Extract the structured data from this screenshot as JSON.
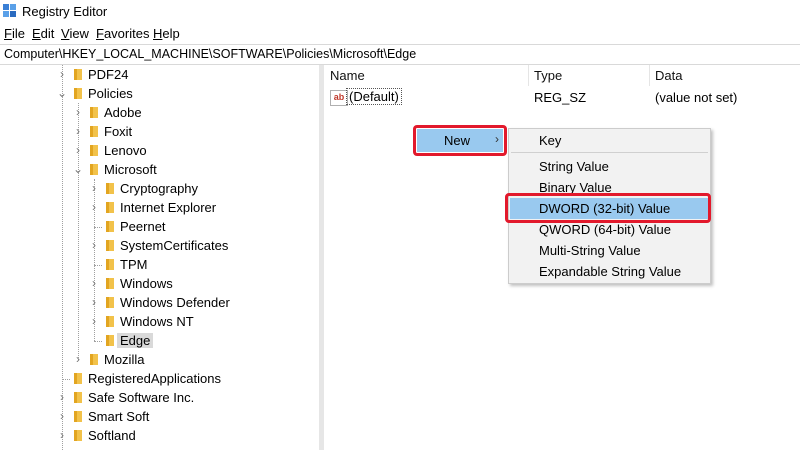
{
  "window": {
    "title": "Registry Editor"
  },
  "menubar": {
    "items": [
      {
        "underline": "F",
        "rest": "ile"
      },
      {
        "underline": "E",
        "rest": "dit"
      },
      {
        "underline": "V",
        "rest": "iew"
      },
      {
        "underline": "F",
        "rest": "avorites",
        "prefix": ""
      },
      {
        "underline": "H",
        "rest": "elp"
      }
    ]
  },
  "address": {
    "path": "Computer\\HKEY_LOCAL_MACHINE\\SOFTWARE\\Policies\\Microsoft\\Edge"
  },
  "tree": {
    "items": [
      {
        "label": "PDF24",
        "chevron": "›"
      },
      {
        "label": "Policies",
        "chevron": "⌄"
      },
      {
        "label": "Adobe",
        "chevron": "›"
      },
      {
        "label": "Foxit",
        "chevron": "›"
      },
      {
        "label": "Lenovo",
        "chevron": "›"
      },
      {
        "label": "Microsoft",
        "chevron": "⌄"
      },
      {
        "label": "Cryptography",
        "chevron": "›"
      },
      {
        "label": "Internet Explorer",
        "chevron": "›"
      },
      {
        "label": "Peernet",
        "chevron": ""
      },
      {
        "label": "SystemCertificates",
        "chevron": "›"
      },
      {
        "label": "TPM",
        "chevron": ""
      },
      {
        "label": "Windows",
        "chevron": "›"
      },
      {
        "label": "Windows Defender",
        "chevron": "›"
      },
      {
        "label": "Windows NT",
        "chevron": "›"
      },
      {
        "label": "Edge",
        "chevron": ""
      },
      {
        "label": "Mozilla",
        "chevron": "›"
      },
      {
        "label": "RegisteredApplications",
        "chevron": ""
      },
      {
        "label": "Safe Software Inc.",
        "chevron": "›"
      },
      {
        "label": "Smart Soft",
        "chevron": "›"
      },
      {
        "label": "Softland",
        "chevron": "›"
      }
    ]
  },
  "values": {
    "headers": {
      "name": "Name",
      "type": "Type",
      "data": "Data"
    },
    "rows": [
      {
        "icon": "ab",
        "name": "(Default)",
        "type": "REG_SZ",
        "data": "(value not set)"
      }
    ]
  },
  "context_menu": {
    "new_label": "New",
    "new_arrow": "›",
    "submenu": {
      "key": "Key",
      "items": [
        "String Value",
        "Binary Value",
        "DWORD (32-bit) Value",
        "QWORD (64-bit) Value",
        "Multi-String Value",
        "Expandable String Value"
      ]
    }
  },
  "colors": {
    "highlight_box": "#e2192c",
    "menu_hover": "#99c9ef",
    "folder": "#f2c24a"
  }
}
